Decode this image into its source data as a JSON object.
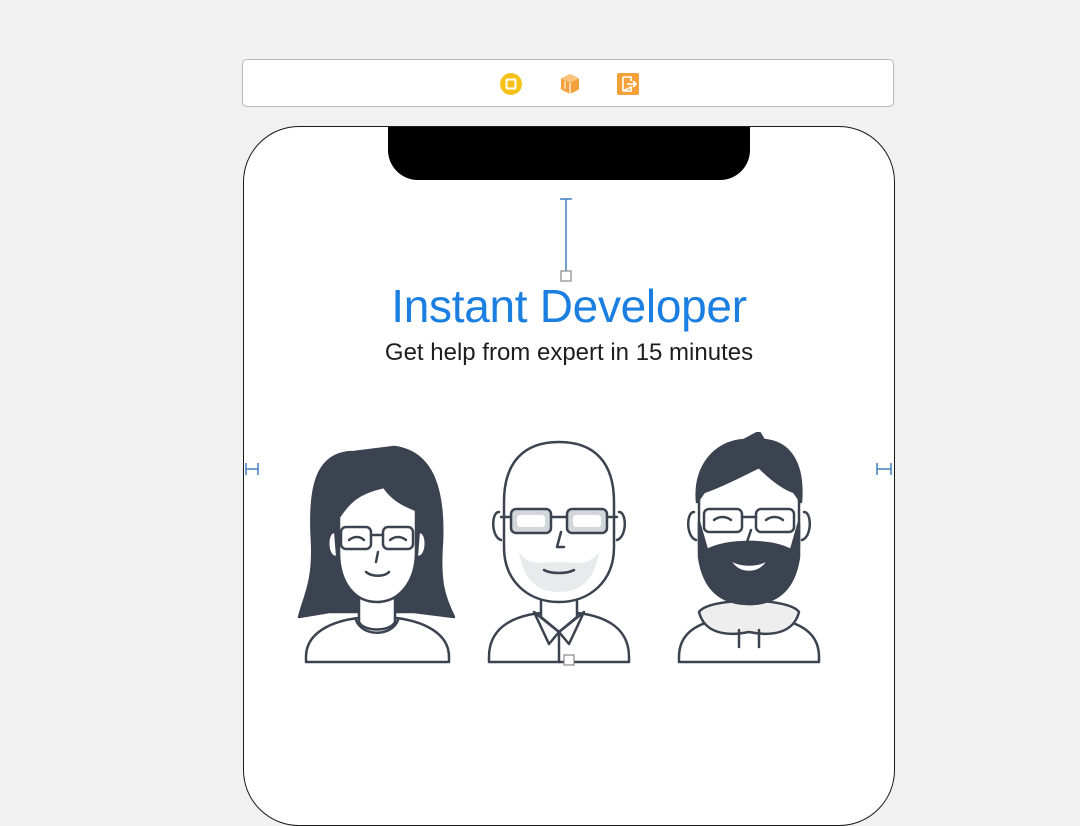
{
  "scene_dock": {
    "icons": [
      {
        "name": "view-controller-icon",
        "color": "#f6c21a"
      },
      {
        "name": "first-responder-icon",
        "color": "#f5a13b"
      },
      {
        "name": "exit-icon",
        "color": "#f5a13b"
      }
    ]
  },
  "screen": {
    "title": "Instant Developer",
    "subtitle": "Get help from expert in 15 minutes",
    "title_color": "#1a7fe0"
  },
  "illustration": {
    "people": [
      "woman-with-glasses-avatar",
      "bald-man-with-glasses-avatar",
      "bearded-man-with-glasses-avatar"
    ]
  },
  "colors": {
    "constraint": "#3d7fbd",
    "line_art": "#3b4350"
  }
}
